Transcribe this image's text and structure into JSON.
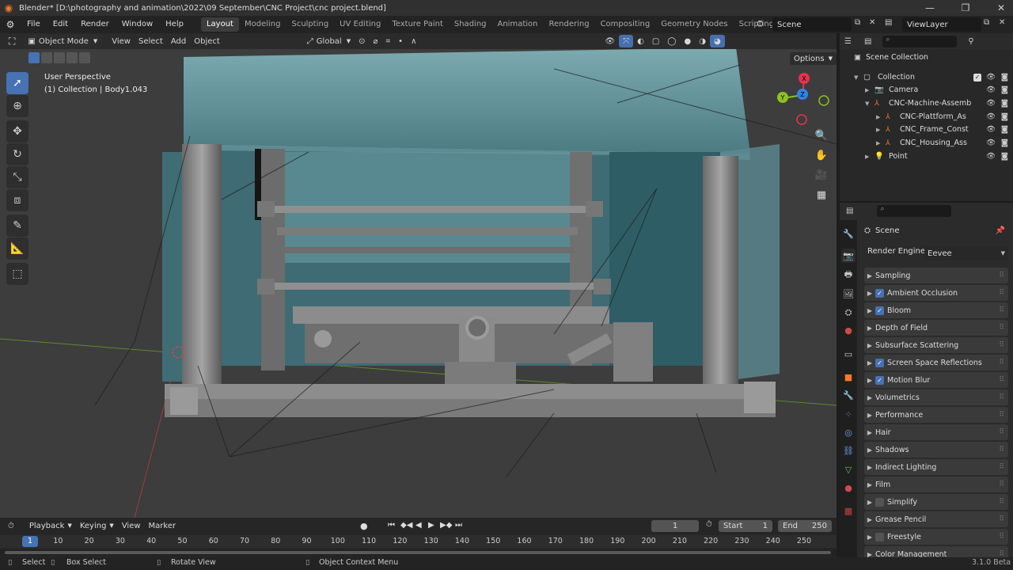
{
  "window": {
    "title": "Blender* [D:\\photography and animation\\2022\\09 September\\CNC Project\\cnc project.blend]",
    "controls": [
      "minimize-icon",
      "maximize-icon",
      "close-icon"
    ]
  },
  "menus": [
    "File",
    "Edit",
    "Render",
    "Window",
    "Help"
  ],
  "workspaces": [
    "Layout",
    "Modeling",
    "Sculpting",
    "UV Editing",
    "Texture Paint",
    "Shading",
    "Animation",
    "Rendering",
    "Compositing",
    "Geometry Nodes",
    "Scripting"
  ],
  "scene": {
    "name": "Scene",
    "view_layer": "ViewLayer"
  },
  "viewport_header": {
    "mode": "Object Mode",
    "menus": [
      "View",
      "Select",
      "Add",
      "Object"
    ],
    "transform_orientation": "Global",
    "options_label": "Options"
  },
  "viewport_overlay": {
    "perspective": "User Perspective",
    "collection_info": "(1) Collection | Body1.043"
  },
  "gizmo": {
    "x": "X",
    "y": "Y",
    "z": "Z"
  },
  "outliner": {
    "root": "Scene Collection",
    "items": [
      {
        "label": "Collection",
        "depth": 1
      },
      {
        "label": "Camera",
        "depth": 2
      },
      {
        "label": "CNC-Machine-Assemb",
        "depth": 2
      },
      {
        "label": "CNC-Plattform_As",
        "depth": 3
      },
      {
        "label": "CNC_Frame_Const",
        "depth": 3
      },
      {
        "label": "CNC_Housing_Ass",
        "depth": 3
      },
      {
        "label": "Point",
        "depth": 2
      }
    ]
  },
  "properties": {
    "context": "Scene",
    "render_engine_label": "Render Engine",
    "render_engine_value": "Eevee",
    "panels": [
      {
        "label": "Sampling",
        "checkbox": null
      },
      {
        "label": "Ambient Occlusion",
        "checkbox": true
      },
      {
        "label": "Bloom",
        "checkbox": true
      },
      {
        "label": "Depth of Field",
        "checkbox": null
      },
      {
        "label": "Subsurface Scattering",
        "checkbox": null
      },
      {
        "label": "Screen Space Reflections",
        "checkbox": true
      },
      {
        "label": "Motion Blur",
        "checkbox": true
      },
      {
        "label": "Volumetrics",
        "checkbox": null
      },
      {
        "label": "Performance",
        "checkbox": null
      },
      {
        "label": "Hair",
        "checkbox": null
      },
      {
        "label": "Shadows",
        "checkbox": null
      },
      {
        "label": "Indirect Lighting",
        "checkbox": null
      },
      {
        "label": "Film",
        "checkbox": null
      },
      {
        "label": "Simplify",
        "checkbox": false
      },
      {
        "label": "Grease Pencil",
        "checkbox": null
      },
      {
        "label": "Freestyle",
        "checkbox": false
      },
      {
        "label": "Color Management",
        "checkbox": null
      }
    ]
  },
  "timeline": {
    "menus": [
      "Playback",
      "Keying",
      "View",
      "Marker"
    ],
    "current_frame": "1",
    "start_label": "Start",
    "start": "1",
    "end_label": "End",
    "end": "250",
    "ruler": [
      "1",
      "10",
      "20",
      "30",
      "40",
      "50",
      "60",
      "70",
      "80",
      "90",
      "100",
      "110",
      "120",
      "130",
      "140",
      "150",
      "160",
      "170",
      "180",
      "190",
      "200",
      "210",
      "220",
      "230",
      "240",
      "250"
    ]
  },
  "statusbar": {
    "select": "Select",
    "box_select": "Box Select",
    "rotate_view": "Rotate View",
    "context_menu": "Object Context Menu",
    "version": "3.1.0 Beta"
  },
  "colors": {
    "accent": "#4772b3",
    "brand": "#f5792a",
    "x_axis": "#e5334d",
    "y_axis": "#8cc21f",
    "z_axis": "#2f83e8"
  }
}
